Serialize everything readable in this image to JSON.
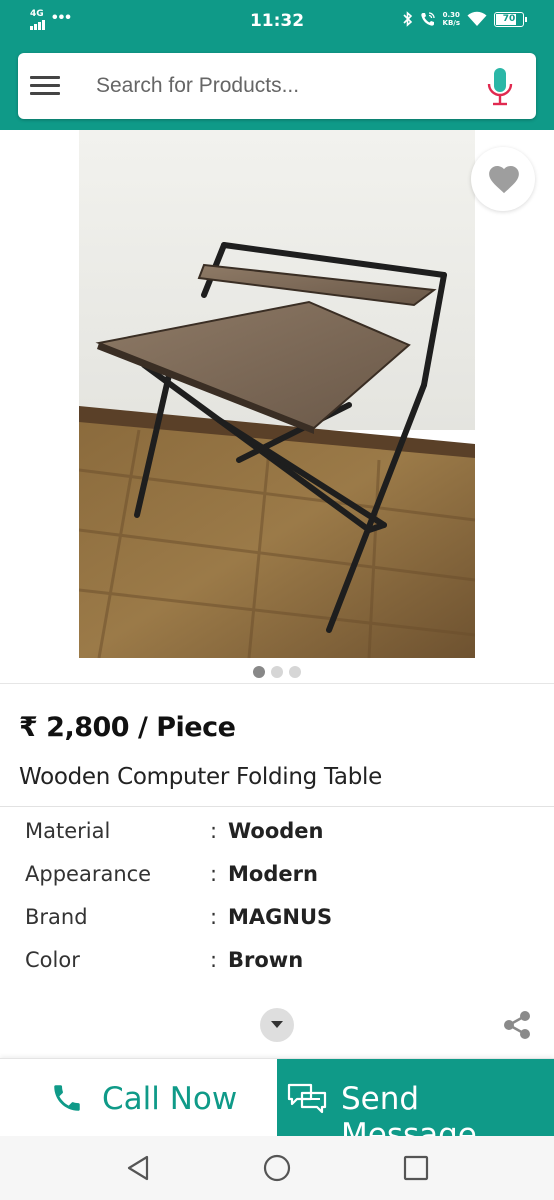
{
  "status_bar": {
    "network": "4G",
    "dots": "•••",
    "time": "11:32",
    "speed_value": "0.30",
    "speed_unit": "KB/s",
    "battery": "70",
    "battery_level": 0.7
  },
  "header": {
    "search_placeholder": "Search for Products...",
    "brand_color": "#0f9a88",
    "mic_color": "#e0294f"
  },
  "gallery": {
    "image_count": 3,
    "active_index": 0
  },
  "product": {
    "price": "₹ 2,800 / Piece",
    "title": "Wooden Computer Folding Table",
    "specs": [
      {
        "label": "Material",
        "value": "Wooden"
      },
      {
        "label": "Appearance",
        "value": "Modern"
      },
      {
        "label": "Brand",
        "value": "MAGNUS"
      },
      {
        "label": "Color",
        "value": "Brown"
      }
    ],
    "spec_separator": ":"
  },
  "actions": {
    "call_label": "Call Now",
    "message_label": "Send Message"
  }
}
